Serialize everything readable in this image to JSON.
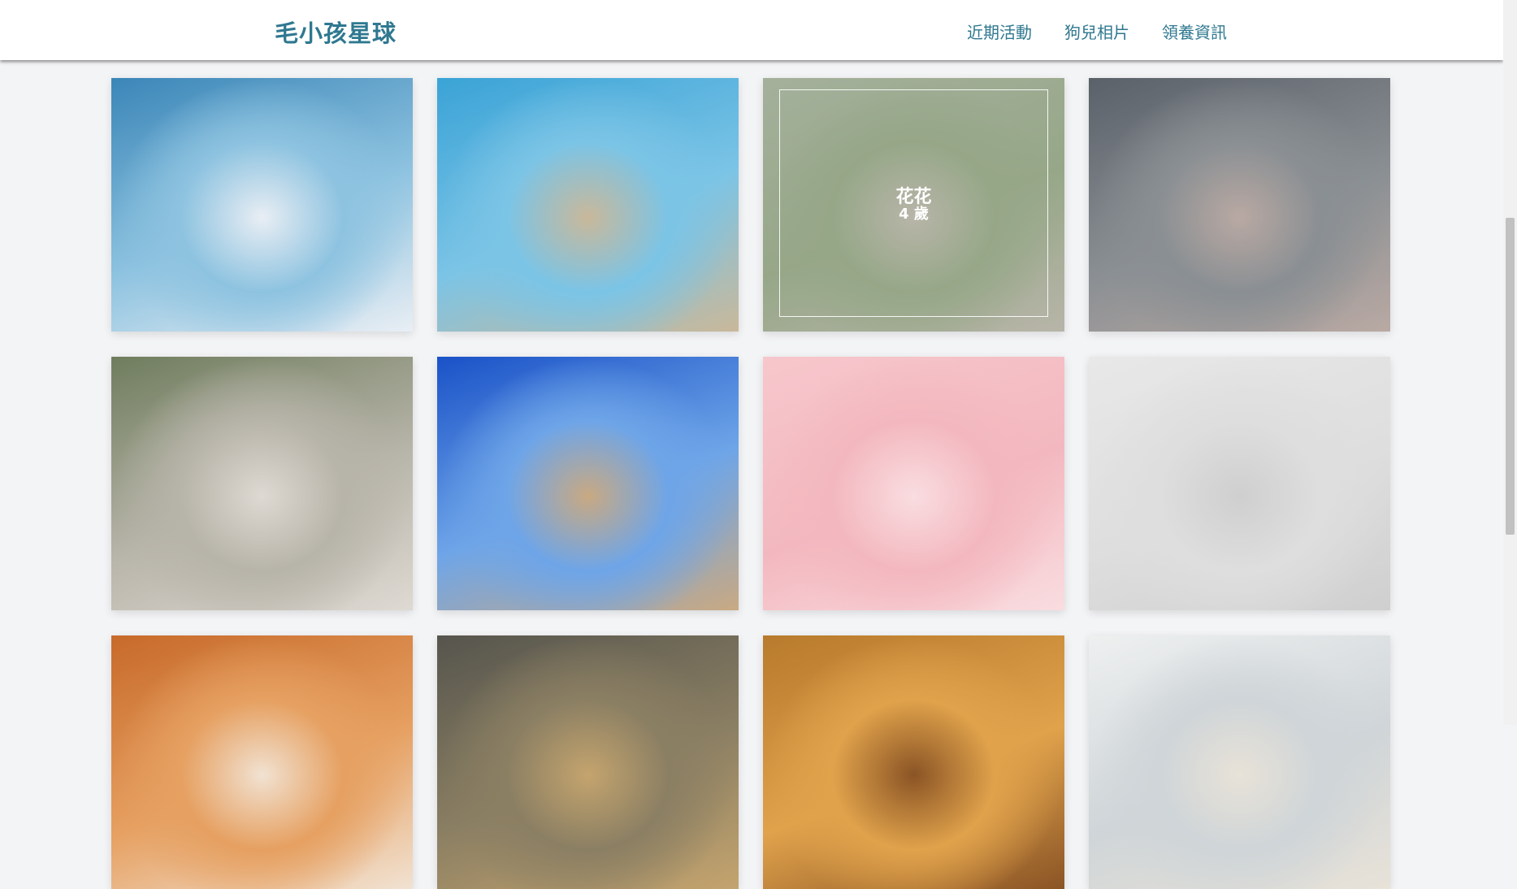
{
  "nav": {
    "brand": "毛小孩星球",
    "links": [
      "近期活動",
      "狗兒相片",
      "領養資訊"
    ]
  },
  "gallery": {
    "hovered_card": {
      "name": "花花",
      "age": "4 歲"
    },
    "photos": [
      {
        "icon": "border-collie-photo",
        "colors": [
          "#3b86b8",
          "#8ec3e0",
          "#e9eef4"
        ]
      },
      {
        "icon": "dog-with-sunglasses-photo",
        "colors": [
          "#3aa3d6",
          "#7bc4e6",
          "#c9b89a"
        ]
      },
      {
        "icon": "corgi-on-grass-photo",
        "colors": [
          "#9fb98a",
          "#7fa460",
          "#c9c3a8"
        ]
      },
      {
        "icon": "border-collie-closeup-photo",
        "colors": [
          "#5a6169",
          "#8a8f93",
          "#b9a9a3"
        ]
      },
      {
        "icon": "golden-retriever-photo",
        "colors": [
          "#6f7d5d",
          "#b7b4a9",
          "#ded9d2"
        ]
      },
      {
        "icon": "corgi-on-beach-photo",
        "colors": [
          "#1a52c8",
          "#6ea5e8",
          "#c9a982"
        ]
      },
      {
        "icon": "pug-party-hat-photo",
        "colors": [
          "#f6c7cc",
          "#f3b8bf",
          "#f9dde0"
        ]
      },
      {
        "icon": "pug-unicorn-costume-photo",
        "colors": [
          "#e8e8e8",
          "#dedede",
          "#cfcfcf"
        ]
      },
      {
        "icon": "chow-chow-photo",
        "colors": [
          "#c76a2a",
          "#e6a061",
          "#f1e2d2"
        ]
      },
      {
        "icon": "dog-in-tunnel-photo",
        "colors": [
          "#56554d",
          "#8b7f63",
          "#c4a46e"
        ]
      },
      {
        "icon": "dog-on-stairs-photo",
        "colors": [
          "#b87a2c",
          "#e0a24b",
          "#8a5425"
        ]
      },
      {
        "icon": "chihuahua-photo",
        "colors": [
          "#eef0f0",
          "#cfd5d8",
          "#e8e2d8"
        ]
      }
    ]
  },
  "colors": {
    "brand": "#2f7890",
    "background": "#f3f4f6"
  }
}
